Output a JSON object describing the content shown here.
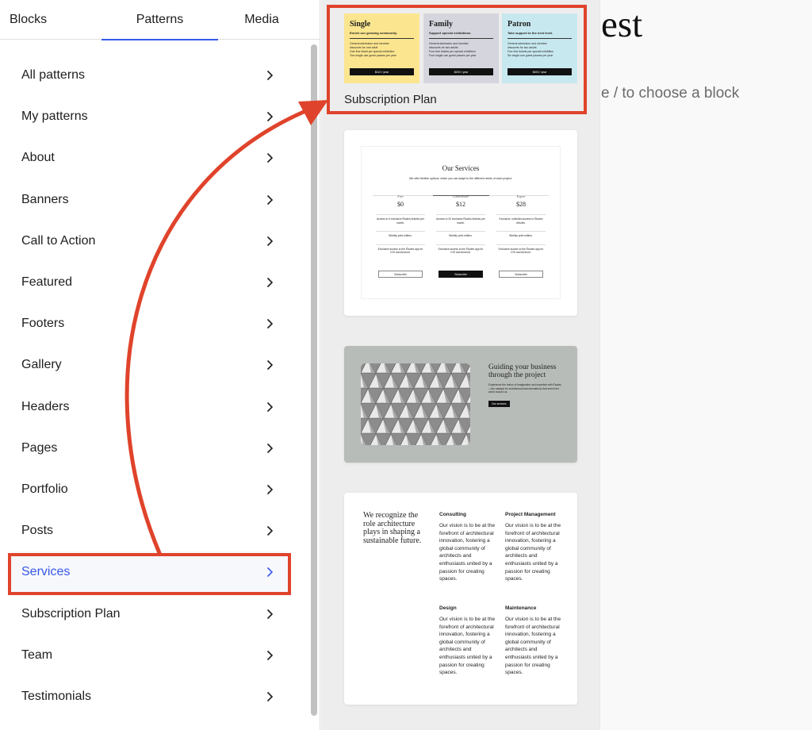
{
  "tabs": [
    {
      "label": "Blocks"
    },
    {
      "label": "Patterns"
    },
    {
      "label": "Media"
    }
  ],
  "categories": [
    {
      "label": "All patterns"
    },
    {
      "label": "My patterns"
    },
    {
      "label": "About"
    },
    {
      "label": "Banners"
    },
    {
      "label": "Call to Action"
    },
    {
      "label": "Featured"
    },
    {
      "label": "Footers"
    },
    {
      "label": "Gallery"
    },
    {
      "label": "Headers"
    },
    {
      "label": "Pages"
    },
    {
      "label": "Portfolio"
    },
    {
      "label": "Posts"
    },
    {
      "label": "Services"
    },
    {
      "label": "Subscription Plan"
    },
    {
      "label": "Team"
    },
    {
      "label": "Testimonials"
    }
  ],
  "active_category": "Services",
  "subscription": {
    "label": "Subscription Plan",
    "tiers": [
      {
        "name": "Single",
        "tagline": "Enrich our growing community.",
        "items": [
          "General admission and member",
          "discounts for one adult",
          "One free ticket per special exhibition",
          "Two single-use guest passes per year"
        ],
        "price": "$110 / year",
        "color": "#fbe58f"
      },
      {
        "name": "Family",
        "tagline": "Support special exhibitions.",
        "items": [
          "General admission and member",
          "discounts for two adults",
          "Four free tickets per special exhibition",
          "Four single-use guest passes per year"
        ],
        "price": "$200 / year",
        "color": "#d5d5de"
      },
      {
        "name": "Patron",
        "tagline": "Take support to the next level.",
        "items": [
          "General admission and member",
          "discounts for two adults",
          "Five free tickets per special exhibition",
          "Six single-use guest passes per year"
        ],
        "price": "$400 / year",
        "color": "#c8e8ef"
      }
    ]
  },
  "services": {
    "title": "Our Services",
    "subtitle": "We offer flexible options, which you can adapt to the different needs of each project.",
    "plans": [
      {
        "tier": "Free",
        "price": "$0",
        "items": [
          "Access to 5 exclusive Études Articles per month.",
          "Weekly print edition.",
          "Exclusive access to the Études app for iOS and Android."
        ],
        "button": "Subscribe"
      },
      {
        "tier": "Connoisseur",
        "price": "$12",
        "items": [
          "Access to 20 exclusive Études Articles per month.",
          "Weekly print edition.",
          "Exclusive access to the Études app for iOS and Android."
        ],
        "button": "Subscribe"
      },
      {
        "tier": "Expert",
        "price": "$28",
        "items": [
          "Exclusive, unlimited access to Études Articles.",
          "Weekly print edition.",
          "Exclusive access to the Études app for iOS and Android."
        ],
        "button": "Subscribe"
      }
    ]
  },
  "guiding": {
    "title": "Guiding your business through the project",
    "text": "Experience the fusion of imagination and expertise with Études—the catalyst for architectural transformations that enrich the world around us.",
    "button": "Our services"
  },
  "architecture": {
    "lead": "We recognize the role architecture plays in shaping a sustainable future.",
    "blocks": [
      {
        "heading": "Consulting",
        "text": "Our vision is to be at the forefront of architectural innovation, fostering a global community of architects and enthusiasts united by a passion for creating spaces."
      },
      {
        "heading": "Project Management",
        "text": "Our vision is to be at the forefront of architectural innovation, fostering a global community of architects and enthusiasts united by a passion for creating spaces."
      },
      {
        "heading": "Design",
        "text": "Our vision is to be at the forefront of architectural innovation, fostering a global community of architects and enthusiasts united by a passion for creating spaces."
      },
      {
        "heading": "Maintenance",
        "text": "Our vision is to be at the forefront of architectural innovation, fostering a global community of architects and enthusiasts united by a passion for creating spaces."
      }
    ]
  },
  "canvas": {
    "title_fragment": "est",
    "hint_fragment": "e / to choose a block"
  },
  "colors": {
    "accent": "#3858e9",
    "annotation": "#e0432b"
  }
}
